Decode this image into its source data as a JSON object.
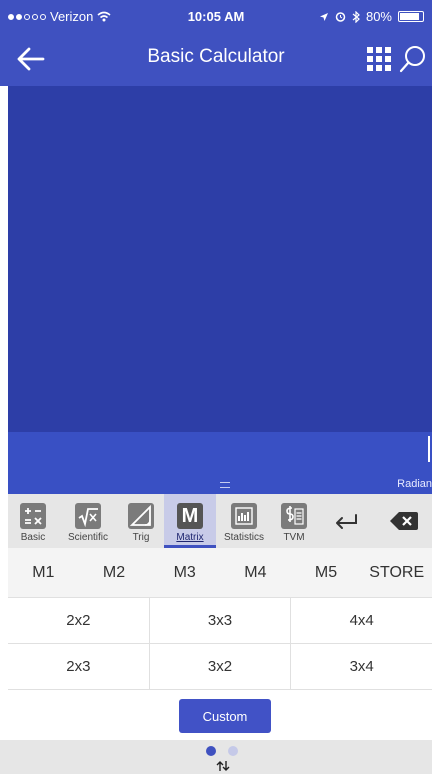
{
  "status": {
    "carrier": "Verizon",
    "time": "10:05 AM",
    "battery": "80%"
  },
  "nav": {
    "title": "Basic Calculator"
  },
  "display": {
    "angle_mode": "Radian"
  },
  "tabs": [
    {
      "label": "Basic",
      "icon": "basic-calculator-icon"
    },
    {
      "label": "Scientific",
      "icon": "square-root-icon"
    },
    {
      "label": "Trig",
      "icon": "triangle-ruler-icon"
    },
    {
      "label": "Matrix",
      "icon": "matrix-m-icon",
      "glyph": "M",
      "active": true
    },
    {
      "label": "Statistics",
      "icon": "bar-chart-icon"
    },
    {
      "label": "TVM",
      "icon": "money-calculator-icon"
    }
  ],
  "memory_keys": [
    "M1",
    "M2",
    "M3",
    "M4",
    "M5",
    "STORE"
  ],
  "matrix_sizes": [
    [
      "2x2",
      "3x3",
      "4x4"
    ],
    [
      "2x3",
      "3x2",
      "3x4"
    ]
  ],
  "custom_label": "Custom",
  "colors": {
    "primary": "#3f51c0",
    "display_dark": "#2d3ea7",
    "input_strip": "#3950c4",
    "active_tab": "#c8cbe8"
  },
  "pager": {
    "pages": 2,
    "current": 1
  }
}
